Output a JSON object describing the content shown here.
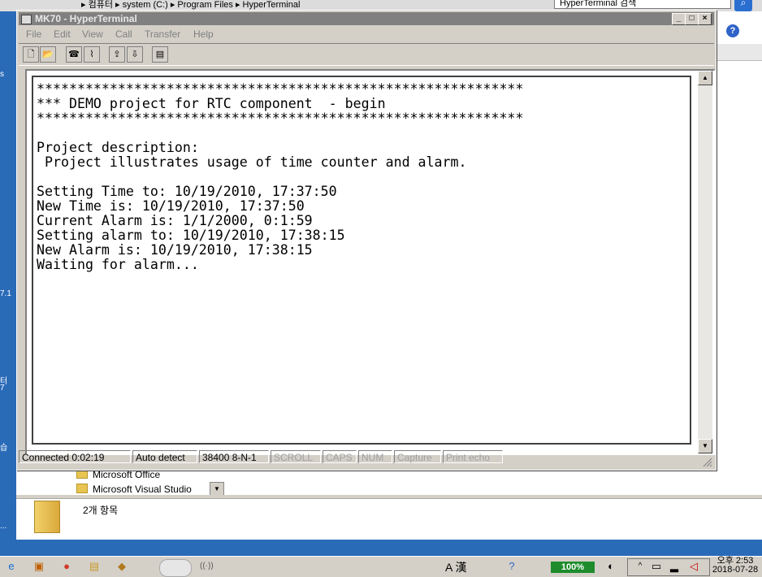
{
  "explorer": {
    "path": "▸ 컴퓨터 ▸ system (C:) ▸ Program Files ▸ HyperTerminal",
    "search_placeholder": "HyperTerminal 검색",
    "list_items": [
      "Microsoft Office",
      "Microsoft Visual Studio"
    ],
    "item_count": "2개 항목",
    "left_fragments": [
      "s",
      "7.1",
      "터",
      "7",
      "습",
      "..."
    ]
  },
  "window": {
    "title": "MK70 - HyperTerminal",
    "controls": {
      "minimize": "_",
      "maximize": "□",
      "close": "×"
    }
  },
  "menu": {
    "items": [
      "File",
      "Edit",
      "View",
      "Call",
      "Transfer",
      "Help"
    ]
  },
  "toolbar": {
    "buttons": [
      {
        "name": "new-icon",
        "glyph": "🗋"
      },
      {
        "name": "open-icon",
        "glyph": "📂"
      },
      {
        "name": "call-icon",
        "glyph": "☎"
      },
      {
        "name": "disconnect-icon",
        "glyph": "⌇"
      },
      {
        "name": "send-icon",
        "glyph": "⇪"
      },
      {
        "name": "receive-icon",
        "glyph": "⇩"
      },
      {
        "name": "properties-icon",
        "glyph": "▤"
      }
    ]
  },
  "terminal": {
    "lines": [
      "************************************************************",
      "*** DEMO project for RTC component  - begin",
      "************************************************************",
      "",
      "Project description:",
      " Project illustrates usage of time counter and alarm.",
      "",
      "Setting Time to: 10/19/2010, 17:37:50",
      "New Time is: 10/19/2010, 17:37:50",
      "Current Alarm is: 1/1/2000, 0:1:59",
      "Setting alarm to: 10/19/2010, 17:38:15",
      "New Alarm is: 10/19/2010, 17:38:15",
      "Waiting for alarm..."
    ]
  },
  "status": {
    "connected": "Connected 0:02:19",
    "detect": "Auto detect",
    "port_settings": "38400 8-N-1",
    "scroll": "SCROLL",
    "caps": "CAPS",
    "num": "NUM",
    "capture": "Capture",
    "print_echo": "Print echo"
  },
  "taskbar": {
    "ime_text": "A 漢",
    "battery": "100%",
    "clock_time": "오후 2:53",
    "clock_date": "2018-07-28"
  }
}
